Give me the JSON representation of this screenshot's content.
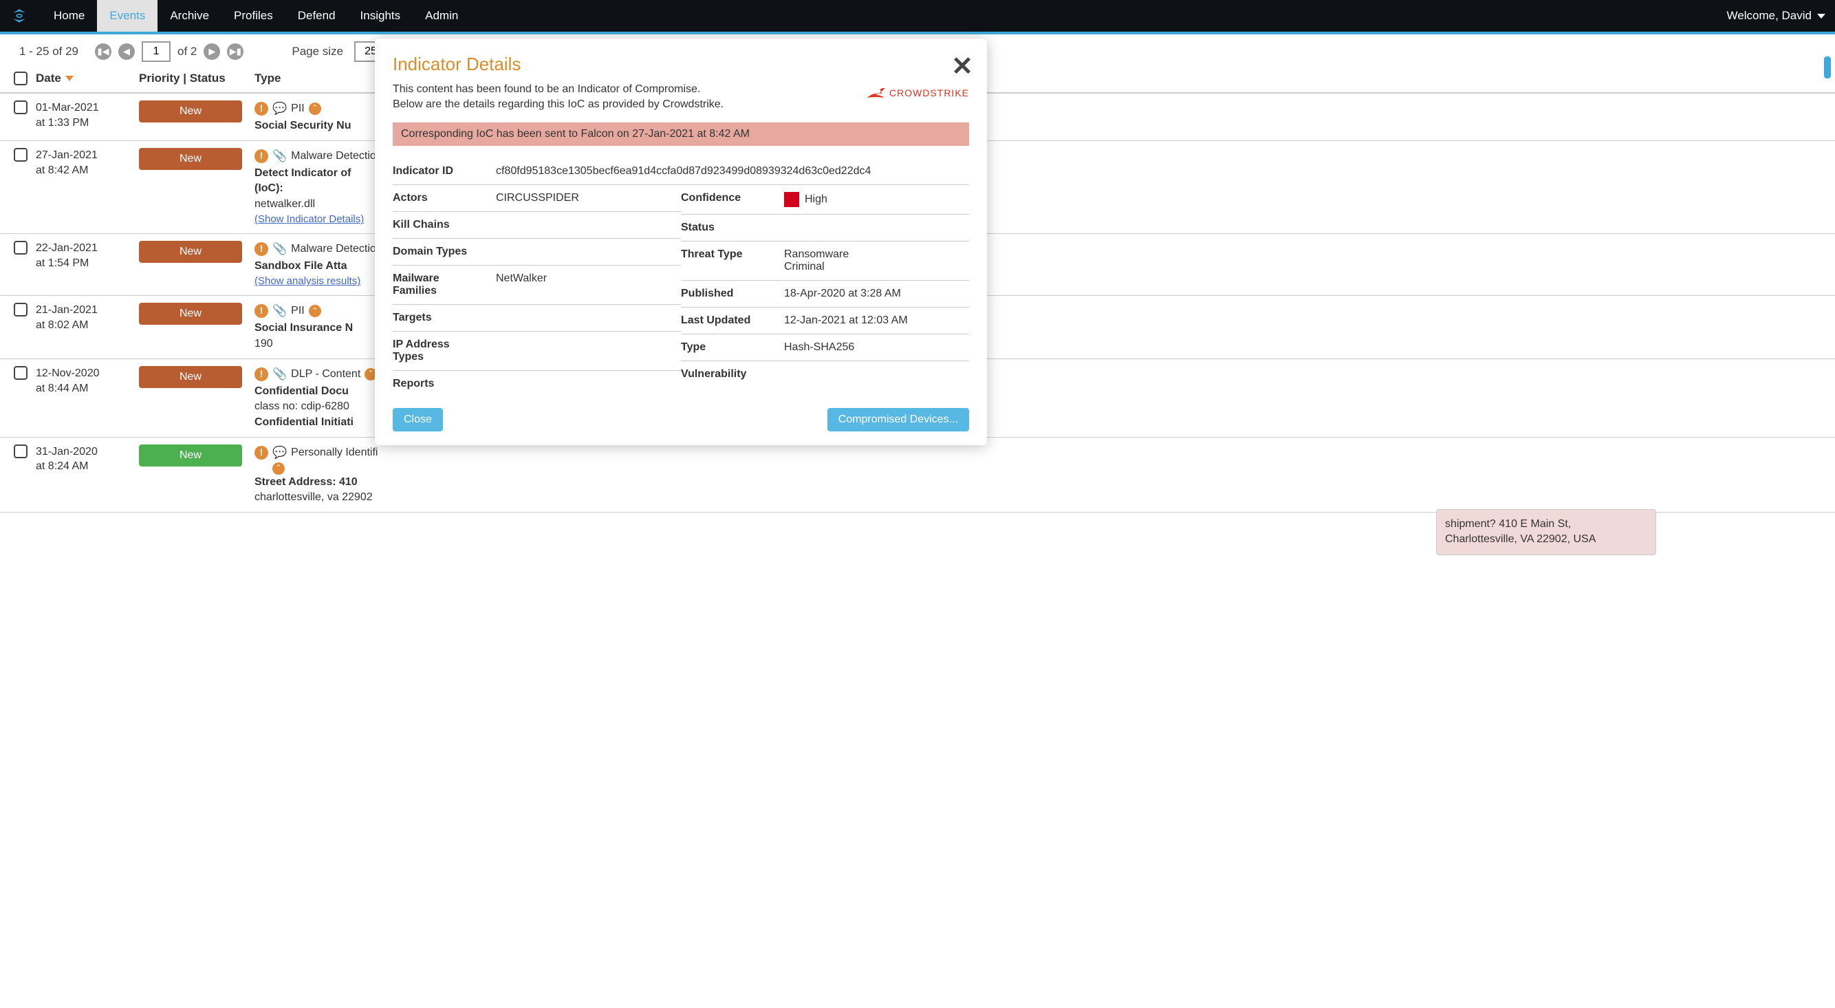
{
  "nav": {
    "items": [
      "Home",
      "Events",
      "Archive",
      "Profiles",
      "Defend",
      "Insights",
      "Admin"
    ],
    "active_index": 1,
    "welcome": "Welcome, David"
  },
  "pagination": {
    "range_text": "1 - 25 of 29",
    "page_input": "1",
    "of_text": "of 2",
    "page_size_label": "Page size",
    "page_size_value": "25"
  },
  "columns": {
    "date": "Date",
    "priority": "Priority | Status",
    "type": "Type"
  },
  "rows": [
    {
      "date": "01-Mar-2021",
      "time": "at 1:33 PM",
      "status": "New",
      "status_color": "brown",
      "icon": "chat",
      "type_label": "PII",
      "chev": true,
      "title": "Social Security Nu"
    },
    {
      "date": "27-Jan-2021",
      "time": "at 8:42 AM",
      "status": "New",
      "status_color": "brown",
      "icon": "clip",
      "type_label": "Malware Detectio",
      "title": "Detect Indicator of",
      "title2": "(IoC):",
      "sub": "netwalker.dll",
      "link": "(Show Indicator Details)"
    },
    {
      "date": "22-Jan-2021",
      "time": "at 1:54 PM",
      "status": "New",
      "status_color": "brown",
      "icon": "clip",
      "type_label": "Malware Detectio",
      "title": "Sandbox File Atta",
      "link": "(Show analysis results)"
    },
    {
      "date": "21-Jan-2021",
      "time": "at 8:02 AM",
      "status": "New",
      "status_color": "brown",
      "icon": "clip",
      "type_label": "PII",
      "chev": true,
      "title": "Social Insurance N",
      "sub": "190"
    },
    {
      "date": "12-Nov-2020",
      "time": "at 8:44 AM",
      "status": "New",
      "status_color": "brown",
      "icon": "clip",
      "type_label": "DLP - Content",
      "chev": true,
      "title": "Confidential Docu",
      "sub": "class no: cdip-6280",
      "title2b": "Confidential Initiati"
    },
    {
      "date": "31-Jan-2020",
      "time": "at 8:24 AM",
      "status": "New",
      "status_color": "green",
      "icon": "chat",
      "type_label": "Personally Identifi",
      "chev_below": true,
      "title": "Street Address: 410",
      "sub": "charlottesville, va 22902"
    }
  ],
  "snippet": {
    "line1": "shipment? 410 E Main St,",
    "line2": "Charlottesville, VA 22902, USA"
  },
  "modal": {
    "title": "Indicator Details",
    "desc1": "This content has been found to be an Indicator of Compromise.",
    "desc2": "Below are the details regarding this IoC as provided by Crowdstrike.",
    "crowdstrike": "CROWDSTRIKE",
    "banner": "Corresponding IoC has been sent to Falcon on 27-Jan-2021 at 8:42 AM",
    "indicator_id_label": "Indicator ID",
    "indicator_id": "cf80fd95183ce1305becf6ea91d4ccfa0d87d923499d08939324d63c0ed22dc4",
    "actors_label": "Actors",
    "actors": "CIRCUSSPIDER",
    "confidence_label": "Confidence",
    "confidence": "High",
    "kill_chains_label": "Kill Chains",
    "kill_chains": "",
    "status_label": "Status",
    "status": "",
    "domain_types_label": "Domain Types",
    "domain_types": "",
    "threat_type_label": "Threat Type",
    "threat_type1": "Ransomware",
    "threat_type2": "Criminal",
    "malware_fam_label": "Mailware Families",
    "malware_fam": "NetWalker",
    "published_label": "Published",
    "published": "18-Apr-2020 at 3:28 AM",
    "targets_label": "Targets",
    "targets": "",
    "last_updated_label": "Last Updated",
    "last_updated": "12-Jan-2021 at 12:03 AM",
    "ip_types_label": "IP Address Types",
    "ip_types": "",
    "type_label": "Type",
    "type": "Hash-SHA256",
    "reports_label": "Reports",
    "reports": "",
    "vuln_label": "Vulnerability",
    "vuln": "",
    "close_btn": "Close",
    "comp_btn": "Compromised Devices..."
  }
}
